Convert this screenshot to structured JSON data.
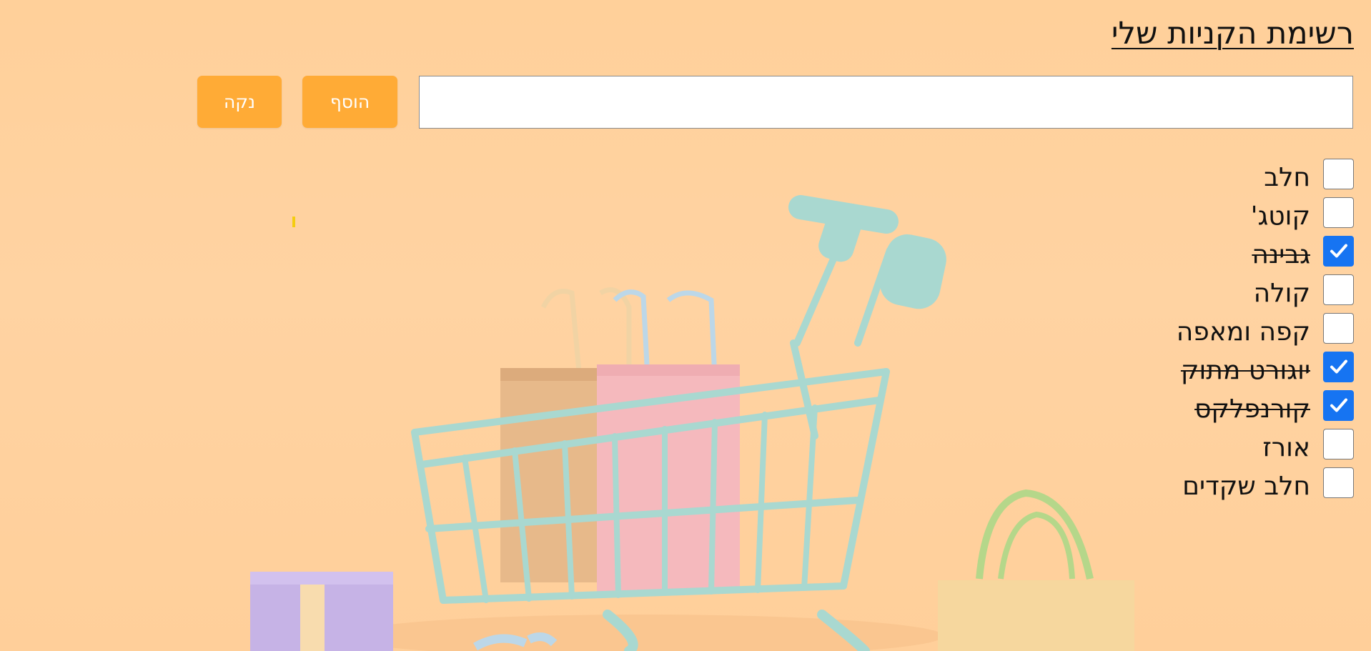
{
  "header": {
    "title": "רשימת הקניות שלי"
  },
  "form": {
    "input_value": "",
    "input_placeholder": "",
    "add_label": "הוסף",
    "clear_label": "נקה"
  },
  "items": [
    {
      "label": "חלב",
      "checked": false
    },
    {
      "label": "קוטג'",
      "checked": false
    },
    {
      "label": "גבינה",
      "checked": true
    },
    {
      "label": "קולה",
      "checked": false
    },
    {
      "label": "קפה ומאפה",
      "checked": false
    },
    {
      "label": "יוגורט מתוק",
      "checked": true
    },
    {
      "label": "קורנפלקס",
      "checked": true
    },
    {
      "label": "אורז",
      "checked": false
    },
    {
      "label": "חלב שקדים",
      "checked": false
    }
  ],
  "colors": {
    "background": "#ffd09a",
    "button": "#ffab36",
    "checkbox_checked": "#1674f2",
    "cart": "#a9d8d0"
  }
}
